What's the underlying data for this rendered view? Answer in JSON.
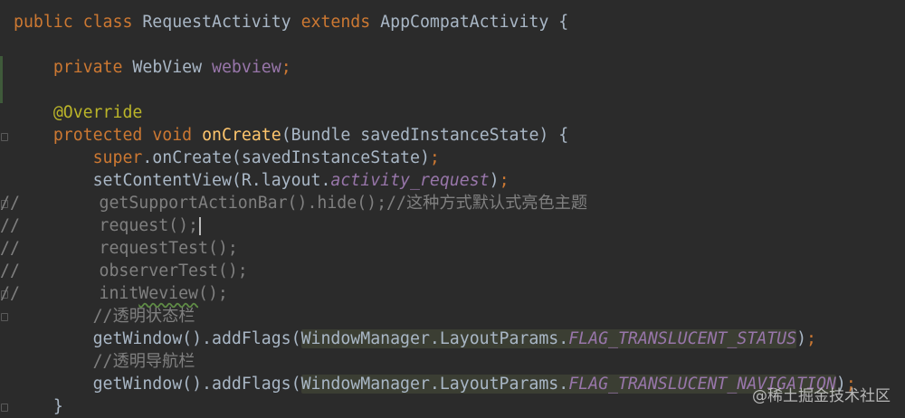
{
  "code": {
    "line1": {
      "kw1": "public",
      "kw2": "class",
      "name": "RequestActivity",
      "kw3": "extends",
      "parent": "AppCompatActivity {"
    },
    "line3": {
      "kw": "private",
      "type": "WebView",
      "field": "webview",
      "end": ";"
    },
    "line5": {
      "annotation": "@Override"
    },
    "line6": {
      "kw1": "protected",
      "kw2": "void",
      "method": "onCreate",
      "params": "(Bundle savedInstanceState) {"
    },
    "line7": {
      "kw": "super",
      "rest": ".onCreate(savedInstanceState)",
      "end": ";"
    },
    "line8": {
      "call": "setContentView(R.layout.",
      "res": "activity_request",
      "close": ")",
      "end": ";"
    },
    "line9": {
      "prefix": "//",
      "text": "        getSupportActionBar().hide();//这种方式默认式亮色主题"
    },
    "line10": {
      "prefix": "//",
      "text": "        request();"
    },
    "line11": {
      "prefix": "//",
      "text": "        requestTest();"
    },
    "line12": {
      "prefix": "//",
      "text": "        observerTest();"
    },
    "line13": {
      "prefix": "//",
      "text1": "        init",
      "squiggle": "Weview",
      "text2": "();"
    },
    "line14": {
      "comment": "//透明状态栏"
    },
    "line15": {
      "call": "getWindow().addFlags(",
      "arg": "WindowManager.LayoutParams.",
      "flag": "FLAG_TRANSLUCENT_STATUS",
      "close": ")",
      "end": ";"
    },
    "line16": {
      "comment": "//透明导航栏"
    },
    "line17": {
      "call": "getWindow().addFlags(",
      "arg": "WindowManager.LayoutParams.",
      "flag": "FLAG_TRANSLUCENT_NAVIGATION",
      "close": ")",
      "end": ";"
    },
    "line18": {
      "brace": "}"
    }
  },
  "watermark": "@稀土掘金技术社区",
  "colors": {
    "background": "#2b2b2b",
    "text": "#a9b7c6",
    "keyword": "#cc7832",
    "method": "#ffc66d",
    "annotation": "#bbb529",
    "field": "#9876aa",
    "comment": "#808080"
  }
}
